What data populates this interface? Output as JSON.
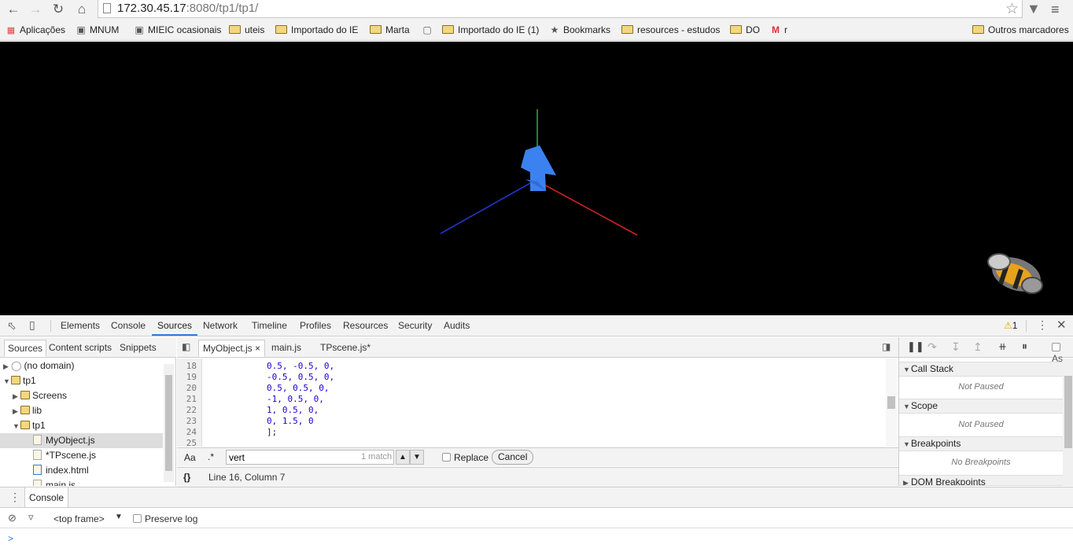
{
  "browser": {
    "url_host": "172.30.45.17",
    "url_rest": ":8080/tp1/tp1/",
    "bookmarks": [
      {
        "label": "Aplicações",
        "icon": "apps-grid-icon"
      },
      {
        "label": "MNUM",
        "icon": "site-icon"
      },
      {
        "label": "MIEIC ocasionais",
        "icon": "site-icon"
      },
      {
        "label": "uteis",
        "icon": "folder-icon"
      },
      {
        "label": "Importado do IE",
        "icon": "folder-icon"
      },
      {
        "label": "Marta",
        "icon": "folder-icon"
      },
      {
        "label": "",
        "icon": "page-icon"
      },
      {
        "label": "Importado do IE (1)",
        "icon": "folder-icon"
      },
      {
        "label": "Bookmarks",
        "icon": "star-icon"
      },
      {
        "label": "resources - estudos",
        "icon": "folder-icon"
      },
      {
        "label": "DO",
        "icon": "folder-icon"
      },
      {
        "label": "r",
        "icon": "gmail-icon"
      }
    ],
    "other_bookmarks": "Outros marcadores"
  },
  "devtools": {
    "tabs": [
      "Elements",
      "Console",
      "Sources",
      "Network",
      "Timeline",
      "Profiles",
      "Resources",
      "Security",
      "Audits"
    ],
    "active_tab": "Sources",
    "warning_count": "1",
    "navigator": {
      "tabs": [
        "Sources",
        "Content scripts",
        "Snippets"
      ],
      "tree": [
        "(no domain)",
        "tp1",
        "Screens",
        "lib",
        "tp1",
        "MyObject.js",
        "*TPscene.js",
        "index.html",
        "main.js"
      ]
    },
    "editor": {
      "tabs": [
        "MyObject.js",
        "main.js",
        "TPscene.js*"
      ],
      "lines": [
        {
          "n": "18",
          "code": "0.5, -0.5, 0,"
        },
        {
          "n": "19",
          "code": "-0.5, 0.5, 0,"
        },
        {
          "n": "20",
          "code": "0.5, 0.5, 0,"
        },
        {
          "n": "21",
          "code": "-1, 0.5, 0,"
        },
        {
          "n": "22",
          "code": "1, 0.5, 0,"
        },
        {
          "n": "23",
          "code": "0, 1.5, 0"
        },
        {
          "n": "24",
          "code": "];"
        },
        {
          "n": "25",
          "code": ""
        }
      ]
    },
    "search": {
      "case_label": "Aa",
      "regex_label": ".*",
      "value": "vert",
      "matches": "1 match",
      "replace_label": "Replace",
      "cancel_label": "Cancel"
    },
    "status": {
      "pretty_print": "{}",
      "position": "Line 16, Column 7"
    },
    "debugger": {
      "async_label": "As",
      "panes": [
        {
          "title": "Call Stack",
          "body": "Not Paused"
        },
        {
          "title": "Scope",
          "body": "Not Paused"
        },
        {
          "title": "Breakpoints",
          "body": "No Breakpoints"
        },
        {
          "title": "DOM Breakpoints",
          "body": ""
        }
      ]
    },
    "drawer": {
      "tab": "Console",
      "context": "<top frame>",
      "preserve_log": "Preserve log",
      "prompt": ">"
    }
  }
}
